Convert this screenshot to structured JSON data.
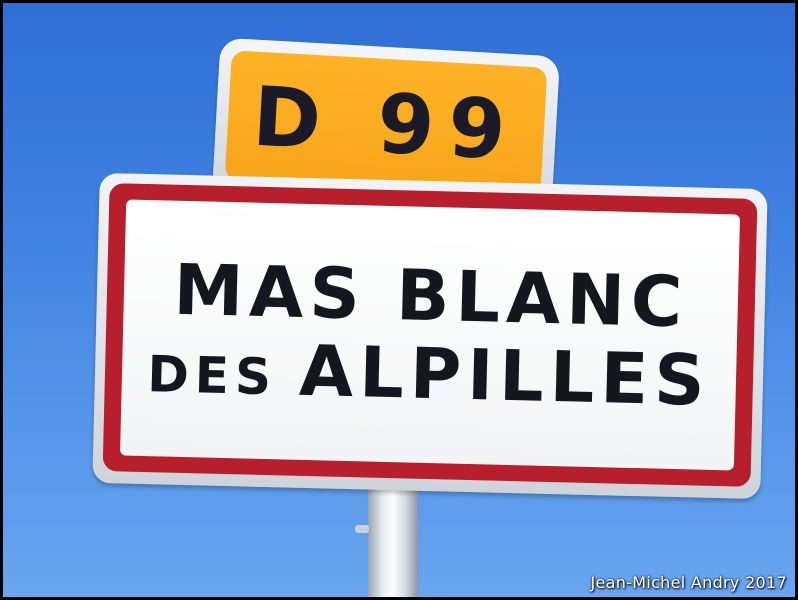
{
  "photo": {
    "subject": "road sign",
    "sky_color": "#3e80e0"
  },
  "route_sign": {
    "text": "D 99",
    "background_color": "#f7a51a",
    "text_color": "#1a1a28"
  },
  "town_sign": {
    "line1": "MAS BLANC",
    "line2_prefix": "DES",
    "line2_main": "ALPILLES",
    "border_color": "#b81f2c",
    "background_color": "#ffffff",
    "text_color": "#16161e"
  },
  "credit": {
    "text": "Jean-Michel Andry 2017"
  }
}
